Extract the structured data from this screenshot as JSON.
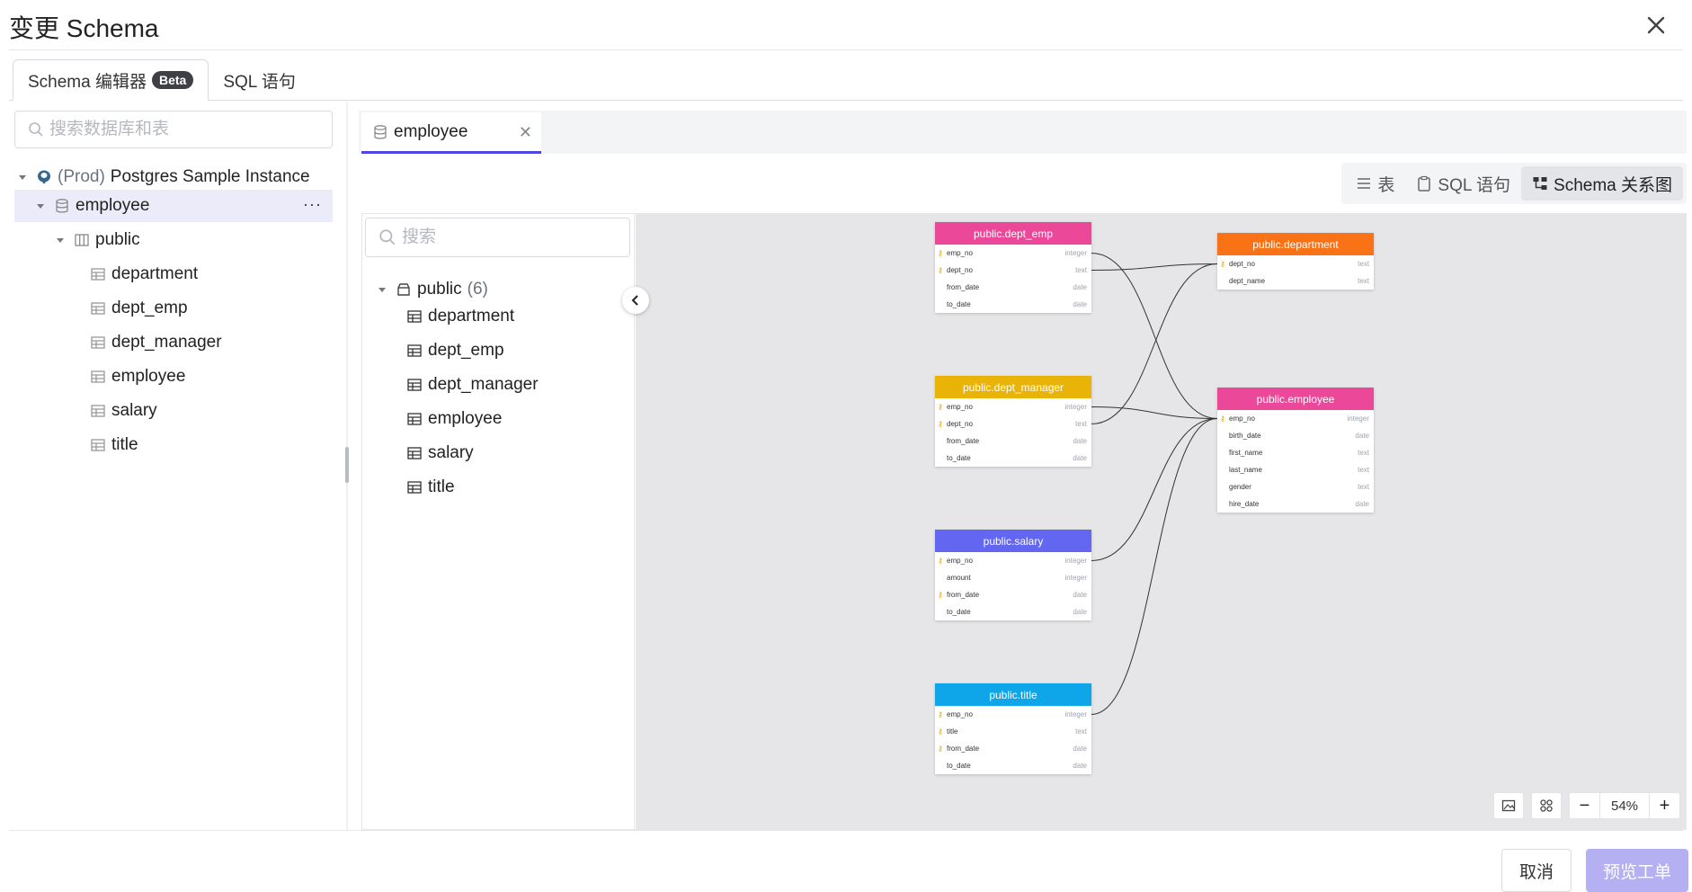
{
  "dialog": {
    "title": "变更 Schema"
  },
  "tabs": [
    {
      "label": "Schema 编辑器",
      "badge": "Beta",
      "active": true
    },
    {
      "label": "SQL 语句",
      "active": false
    }
  ],
  "left": {
    "search_placeholder": "搜索数据库和表",
    "instance": {
      "env": "(Prod)",
      "name": "Postgres Sample Instance"
    },
    "database": "employee",
    "schema": "public",
    "tables": [
      "department",
      "dept_emp",
      "dept_manager",
      "employee",
      "salary",
      "title"
    ]
  },
  "editor": {
    "open_tab": "employee",
    "views": [
      {
        "label": "表",
        "icon": "list-icon"
      },
      {
        "label": "SQL 语句",
        "icon": "clipboard-icon"
      },
      {
        "label": "Schema 关系图",
        "icon": "diagram-icon",
        "active": true
      }
    ],
    "search_placeholder": "搜索",
    "schema_label": "public",
    "schema_count": "(6)",
    "tables": [
      "department",
      "dept_emp",
      "dept_manager",
      "employee",
      "salary",
      "title"
    ]
  },
  "erd": {
    "tables": [
      {
        "name": "public.dept_emp",
        "color": "#ec4899",
        "columns": [
          {
            "name": "emp_no",
            "type": "integer",
            "key": true
          },
          {
            "name": "dept_no",
            "type": "text",
            "key": true
          },
          {
            "name": "from_date",
            "type": "date",
            "key": false
          },
          {
            "name": "to_date",
            "type": "date",
            "key": false
          }
        ]
      },
      {
        "name": "public.department",
        "color": "#f97316",
        "columns": [
          {
            "name": "dept_no",
            "type": "text",
            "key": true
          },
          {
            "name": "dept_name",
            "type": "text",
            "key": false
          }
        ]
      },
      {
        "name": "public.dept_manager",
        "color": "#eab308",
        "columns": [
          {
            "name": "emp_no",
            "type": "integer",
            "key": true
          },
          {
            "name": "dept_no",
            "type": "text",
            "key": true
          },
          {
            "name": "from_date",
            "type": "date",
            "key": false
          },
          {
            "name": "to_date",
            "type": "date",
            "key": false
          }
        ]
      },
      {
        "name": "public.employee",
        "color": "#ec4899",
        "columns": [
          {
            "name": "emp_no",
            "type": "integer",
            "key": true
          },
          {
            "name": "birth_date",
            "type": "date",
            "key": false
          },
          {
            "name": "first_name",
            "type": "text",
            "key": false
          },
          {
            "name": "last_name",
            "type": "text",
            "key": false
          },
          {
            "name": "gender",
            "type": "text",
            "key": false
          },
          {
            "name": "hire_date",
            "type": "date",
            "key": false
          }
        ]
      },
      {
        "name": "public.salary",
        "color": "#6366f1",
        "columns": [
          {
            "name": "emp_no",
            "type": "integer",
            "key": true
          },
          {
            "name": "amount",
            "type": "integer",
            "key": false
          },
          {
            "name": "from_date",
            "type": "date",
            "key": true
          },
          {
            "name": "to_date",
            "type": "date",
            "key": false
          }
        ]
      },
      {
        "name": "public.title",
        "color": "#0ea5e9",
        "columns": [
          {
            "name": "emp_no",
            "type": "integer",
            "key": true
          },
          {
            "name": "title",
            "type": "text",
            "key": true
          },
          {
            "name": "from_date",
            "type": "date",
            "key": true
          },
          {
            "name": "to_date",
            "type": "date",
            "key": false
          }
        ]
      }
    ],
    "zoom": "54%"
  },
  "footer": {
    "cancel": "取消",
    "preview": "预览工单"
  }
}
